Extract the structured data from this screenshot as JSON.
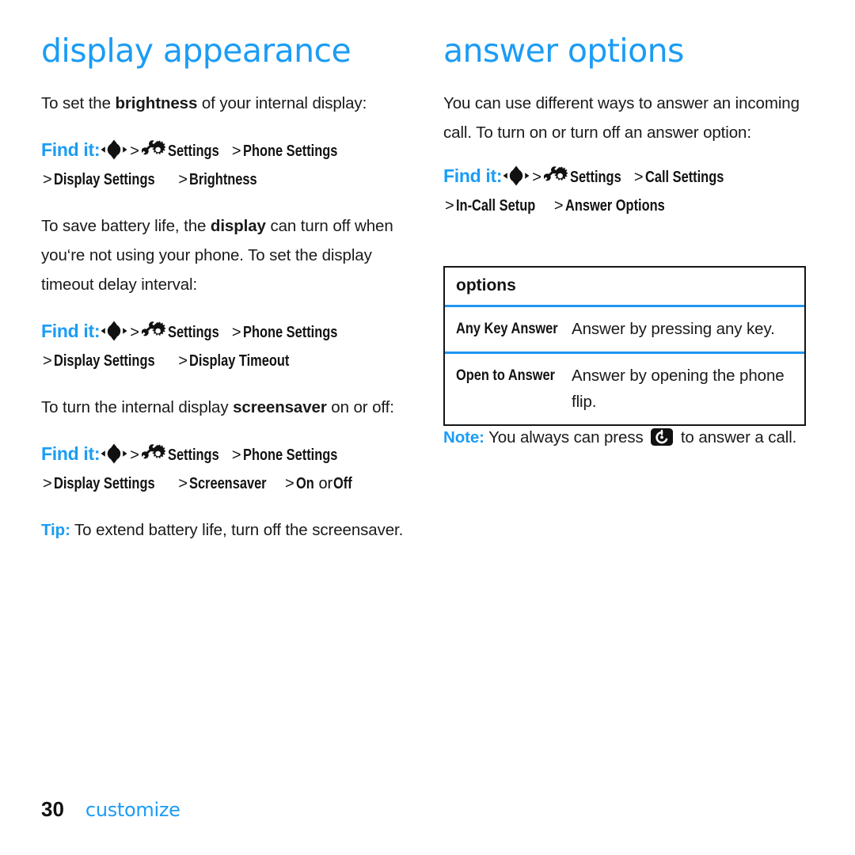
{
  "document": {
    "footer": {
      "page_number": "30",
      "chapter_label": "customize"
    }
  },
  "icons": {
    "nav_key": "navigation-dpad-icon",
    "settings": "settings-wrench-gear-icon",
    "send_key": "send-call-key-icon"
  },
  "left_column": {
    "title": "display appearance",
    "intro": {
      "pre": "To set the ",
      "bold": "brightness",
      "post": " of your internal display:"
    },
    "findit_1": {
      "label": "Find it:",
      "sep": ">",
      "settings": "Settings",
      "crumb_1": "Phone Settings",
      "crumb_2": "Display Settings",
      "crumb_3": "Brightness"
    },
    "para_battery": {
      "pre": "To save battery life, the ",
      "bold": "display",
      "post": " can turn off when you‘re not using your phone. To set the display timeout delay interval:"
    },
    "findit_2": {
      "label": "Find it:",
      "sep": ">",
      "settings": "Settings",
      "crumb_1": "Phone Settings",
      "crumb_2": "Display Settings",
      "crumb_3": "Display Timeout"
    },
    "para_screensaver": {
      "pre": "To turn the internal display ",
      "bold": "screensaver",
      "post": " on or off:"
    },
    "findit_3": {
      "label": "Find it:",
      "sep": ">",
      "settings": "Settings",
      "crumb_1": "Phone Settings",
      "crumb_2": "Display Settings",
      "crumb_3": "Screensaver",
      "crumb_4": "On",
      "or_word": "or",
      "crumb_5": "Off"
    },
    "tip": {
      "lead": "Tip:",
      "text": " To extend battery life, turn off the screensaver."
    }
  },
  "right_column": {
    "title": "answer options",
    "intro": "You can use different ways to answer an incoming call. To turn on or turn off an answer option:",
    "findit_1": {
      "label": "Find it:",
      "sep": ">",
      "settings": "Settings",
      "crumb_1": "Call Settings",
      "crumb_2": "In-Call Setup",
      "crumb_3": "Answer Options"
    },
    "options_table": {
      "header": "options",
      "rows": [
        {
          "name": "Any Key Answer",
          "description": "Answer by pressing any key."
        },
        {
          "name": "Open to Answer",
          "description": "Answer by opening the phone flip."
        }
      ]
    },
    "note": {
      "lead": "Note:",
      "pre": " You always can press ",
      "post": " to answer a call."
    }
  },
  "colors": {
    "heading_blue": "#1b9cf5",
    "divider_blue": "#2196f3",
    "border_black": "#161616",
    "body_text": "#1a1a1a"
  }
}
